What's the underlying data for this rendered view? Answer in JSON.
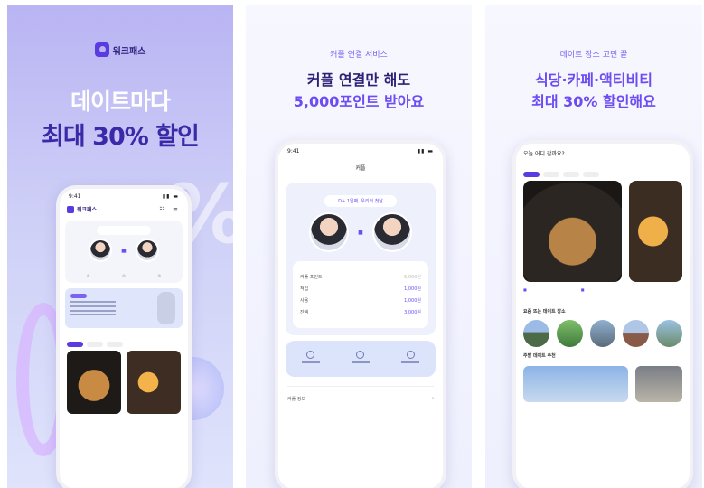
{
  "panel1": {
    "brand_name": "워크패스",
    "headline_line1": "데이트마다",
    "headline_line2": "최대 30% 할인",
    "phone": {
      "time": "9:41",
      "app_name": "워크패스",
      "food_labels": [
        "이곳 가게",
        "이곳 가게"
      ]
    }
  },
  "panel2": {
    "eyebrow": "커플 연결 서비스",
    "headline_line1": "커플 연결만 해도",
    "headline_line2": "5,000포인트 받아요",
    "phone": {
      "time": "9:41",
      "screen_title": "커플",
      "pill": "D+ 1일째, 우리의 첫날",
      "rows": [
        {
          "label": "커플 포인트",
          "value": "5,000원"
        },
        {
          "label": "적립",
          "value": "1,000원"
        },
        {
          "label": "사용",
          "value": "1,000원"
        },
        {
          "label": "잔액",
          "value": "3,000원"
        }
      ],
      "actions": [
        "커플 연결",
        "데이트",
        "설정"
      ],
      "menu": [
        "커플 정보"
      ]
    }
  },
  "panel3": {
    "eyebrow": "데이트 장소 고민 끝",
    "headline_line1": "식당·카페·액티비티",
    "headline_line2": "최대 30% 할인해요",
    "phone": {
      "question": "오늘 어디 갈까요?",
      "section2": "요즘 뜨는 데이트 장소",
      "section3": "주말 데이트 추천"
    }
  },
  "colors": {
    "accent": "#6d4cf2",
    "navy": "#2b2275",
    "brand": "#5a3be0"
  }
}
